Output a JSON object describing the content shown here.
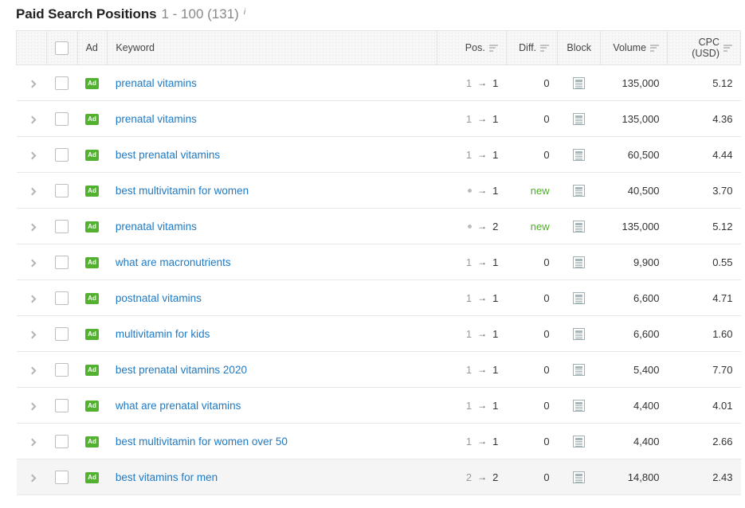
{
  "header": {
    "title": "Paid Search Positions",
    "range": "1 - 100 (131)",
    "info_icon": "info-icon"
  },
  "table": {
    "columns": [
      {
        "key": "expand",
        "label": ""
      },
      {
        "key": "select",
        "label": ""
      },
      {
        "key": "ad",
        "label": "Ad"
      },
      {
        "key": "keyword",
        "label": "Keyword"
      },
      {
        "key": "pos",
        "label": "Pos.",
        "sortable": true
      },
      {
        "key": "diff",
        "label": "Diff.",
        "sortable": true
      },
      {
        "key": "block",
        "label": "Block"
      },
      {
        "key": "volume",
        "label": "Volume",
        "sortable": true
      },
      {
        "key": "cpc",
        "label": "CPC (USD)",
        "sortable": true
      }
    ],
    "ad_badge_label": "Ad",
    "arrow_glyph": "→",
    "rows": [
      {
        "keyword": "prenatal vitamins",
        "pos_prev": "1",
        "pos_new": "1",
        "diff": "0",
        "diff_state": "zero",
        "volume": "135,000",
        "cpc": "5.12",
        "hover": false
      },
      {
        "keyword": "prenatal vitamins",
        "pos_prev": "1",
        "pos_new": "1",
        "diff": "0",
        "diff_state": "zero",
        "volume": "135,000",
        "cpc": "4.36",
        "hover": false
      },
      {
        "keyword": "best prenatal vitamins",
        "pos_prev": "1",
        "pos_new": "1",
        "diff": "0",
        "diff_state": "zero",
        "volume": "60,500",
        "cpc": "4.44",
        "hover": false
      },
      {
        "keyword": "best multivitamin for women",
        "pos_prev": null,
        "pos_new": "1",
        "diff": "new",
        "diff_state": "new",
        "volume": "40,500",
        "cpc": "3.70",
        "hover": false
      },
      {
        "keyword": "prenatal vitamins",
        "pos_prev": null,
        "pos_new": "2",
        "diff": "new",
        "diff_state": "new",
        "volume": "135,000",
        "cpc": "5.12",
        "hover": false
      },
      {
        "keyword": "what are macronutrients",
        "pos_prev": "1",
        "pos_new": "1",
        "diff": "0",
        "diff_state": "zero",
        "volume": "9,900",
        "cpc": "0.55",
        "hover": false
      },
      {
        "keyword": "postnatal vitamins",
        "pos_prev": "1",
        "pos_new": "1",
        "diff": "0",
        "diff_state": "zero",
        "volume": "6,600",
        "cpc": "4.71",
        "hover": false
      },
      {
        "keyword": "multivitamin for kids",
        "pos_prev": "1",
        "pos_new": "1",
        "diff": "0",
        "diff_state": "zero",
        "volume": "6,600",
        "cpc": "1.60",
        "hover": false
      },
      {
        "keyword": "best prenatal vitamins 2020",
        "pos_prev": "1",
        "pos_new": "1",
        "diff": "0",
        "diff_state": "zero",
        "volume": "5,400",
        "cpc": "7.70",
        "hover": false
      },
      {
        "keyword": "what are prenatal vitamins",
        "pos_prev": "1",
        "pos_new": "1",
        "diff": "0",
        "diff_state": "zero",
        "volume": "4,400",
        "cpc": "4.01",
        "hover": false
      },
      {
        "keyword": "best multivitamin for women over 50",
        "pos_prev": "1",
        "pos_new": "1",
        "diff": "0",
        "diff_state": "zero",
        "volume": "4,400",
        "cpc": "2.66",
        "hover": false
      },
      {
        "keyword": "best vitamins for men",
        "pos_prev": "2",
        "pos_new": "2",
        "diff": "0",
        "diff_state": "zero",
        "volume": "14,800",
        "cpc": "2.43",
        "hover": true
      }
    ]
  },
  "colors": {
    "link": "#1f7ac4",
    "ad_badge": "#52b22f",
    "new": "#4caf22",
    "header_bg": "#f7f7f7",
    "border": "#e3e3e3"
  }
}
